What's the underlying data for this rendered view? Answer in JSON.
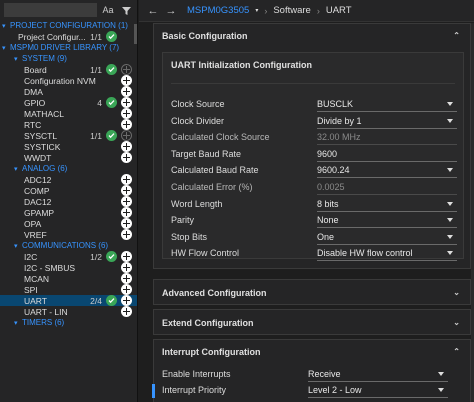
{
  "sidebar": {
    "font_toggle": "Aa",
    "project_config": {
      "header": "PROJECT CONFIGURATION (1)",
      "items": [
        {
          "label": "Project Configur...",
          "count": "1/1",
          "ok": true,
          "add": false
        }
      ]
    },
    "library_header": "MSPM0 DRIVER LIBRARY (7)",
    "groups": [
      {
        "header": "SYSTEM (9)",
        "items": [
          {
            "label": "Board",
            "count": "1/1",
            "ok": true,
            "add_dim": true
          },
          {
            "label": "Configuration NVM",
            "count": "",
            "ok": false
          },
          {
            "label": "DMA",
            "count": "",
            "ok": false
          },
          {
            "label": "GPIO",
            "count": "4",
            "ok": true
          },
          {
            "label": "MATHACL",
            "count": "",
            "ok": false
          },
          {
            "label": "RTC",
            "count": "",
            "ok": false
          },
          {
            "label": "SYSCTL",
            "count": "1/1",
            "ok": true,
            "add_dim": true
          },
          {
            "label": "SYSTICK",
            "count": "",
            "ok": false
          },
          {
            "label": "WWDT",
            "count": "",
            "ok": false
          }
        ]
      },
      {
        "header": "ANALOG (6)",
        "items": [
          {
            "label": "ADC12",
            "count": "",
            "ok": false
          },
          {
            "label": "COMP",
            "count": "",
            "ok": false
          },
          {
            "label": "DAC12",
            "count": "",
            "ok": false
          },
          {
            "label": "GPAMP",
            "count": "",
            "ok": false
          },
          {
            "label": "OPA",
            "count": "",
            "ok": false
          },
          {
            "label": "VREF",
            "count": "",
            "ok": false
          }
        ]
      },
      {
        "header": "COMMUNICATIONS (6)",
        "items": [
          {
            "label": "I2C",
            "count": "1/2",
            "ok": true
          },
          {
            "label": "I2C - SMBUS",
            "count": "",
            "ok": false
          },
          {
            "label": "MCAN",
            "count": "",
            "ok": false
          },
          {
            "label": "SPI",
            "count": "",
            "ok": false
          },
          {
            "label": "UART",
            "count": "2/4",
            "ok": true,
            "selected": true
          },
          {
            "label": "UART - LIN",
            "count": "",
            "ok": false
          }
        ]
      },
      {
        "header": "TIMERS (6)",
        "items": []
      }
    ]
  },
  "topbar": {
    "device": "MSPM0G3505",
    "crumbs": [
      "Software",
      "UART"
    ]
  },
  "basic": {
    "title": "Basic Configuration",
    "uart_init": {
      "title": "UART Initialization Configuration",
      "fields": [
        {
          "label": "Clock Source",
          "value": "BUSCLK",
          "type": "dropdown"
        },
        {
          "label": "Clock Divider",
          "value": "Divide by 1",
          "type": "dropdown"
        },
        {
          "label": "Calculated Clock Source",
          "value": "32.00 MHz",
          "type": "readonly"
        },
        {
          "label": "Target Baud Rate",
          "value": "9600",
          "type": "input"
        },
        {
          "label": "Calculated Baud Rate",
          "value": "9600.24",
          "type": "dropdown"
        },
        {
          "label": "Calculated Error (%)",
          "value": "0.0025",
          "type": "readonly"
        },
        {
          "label": "Word Length",
          "value": "8 bits",
          "type": "dropdown"
        },
        {
          "label": "Parity",
          "value": "None",
          "type": "dropdown"
        },
        {
          "label": "Stop Bits",
          "value": "One",
          "type": "dropdown"
        },
        {
          "label": "HW Flow Control",
          "value": "Disable HW flow control",
          "type": "dropdown"
        }
      ]
    }
  },
  "advanced": {
    "title": "Advanced Configuration"
  },
  "extend": {
    "title": "Extend Configuration"
  },
  "interrupt": {
    "title": "Interrupt Configuration",
    "fields": [
      {
        "label": "Enable Interrupts",
        "value": "Receive",
        "type": "dropdown"
      },
      {
        "label": "Interrupt Priority",
        "value": "Level 2 - Low",
        "type": "dropdown"
      }
    ]
  },
  "colors": {
    "accent_blue": "#3794ff",
    "ok_green": "#3aa657",
    "selection": "#094771"
  }
}
